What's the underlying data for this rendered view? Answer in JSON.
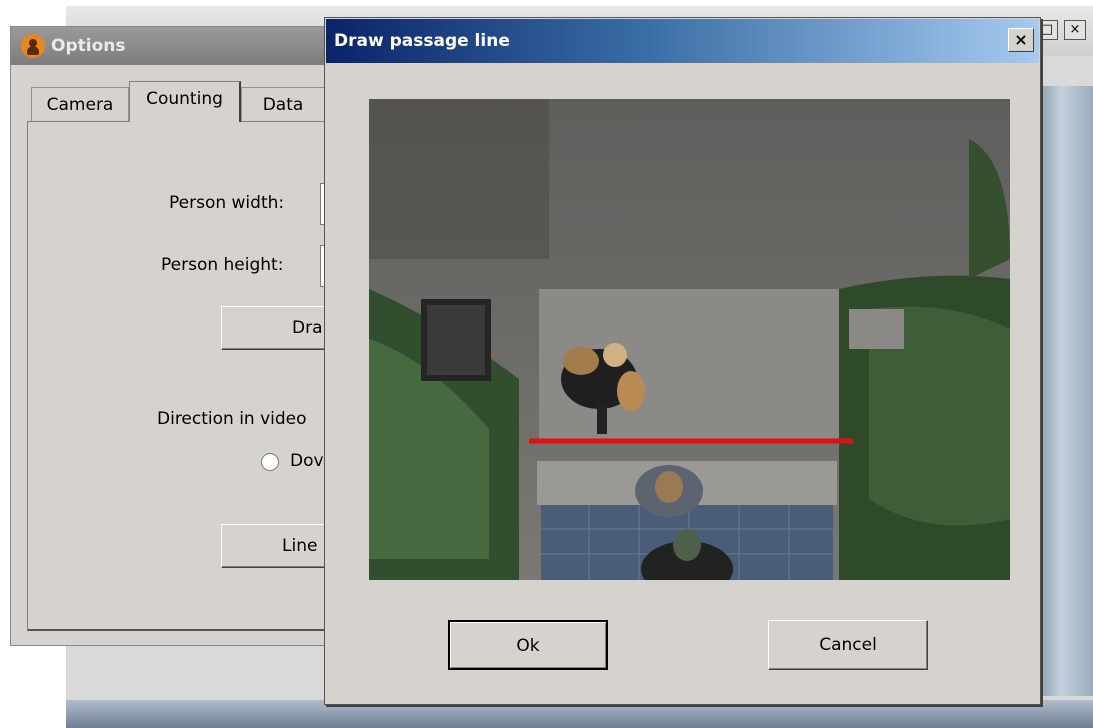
{
  "background": {
    "controls": [
      "□",
      "×"
    ]
  },
  "options_dialog": {
    "title": "Options",
    "tabs": [
      {
        "label": "Camera"
      },
      {
        "label": "Counting"
      },
      {
        "label": "Data"
      }
    ],
    "active_tab": "Counting",
    "person_width_label": "Person width:",
    "person_height_label": "Person height:",
    "draw_button_label": "Dra",
    "direction_label": "Direction in video",
    "radio_label": "Dov",
    "line_button_label": "Line"
  },
  "passage_dialog": {
    "title": "Draw passage line",
    "close_label": "×",
    "ok_label": "Ok",
    "cancel_label": "Cancel",
    "line_color": "#e01010"
  }
}
